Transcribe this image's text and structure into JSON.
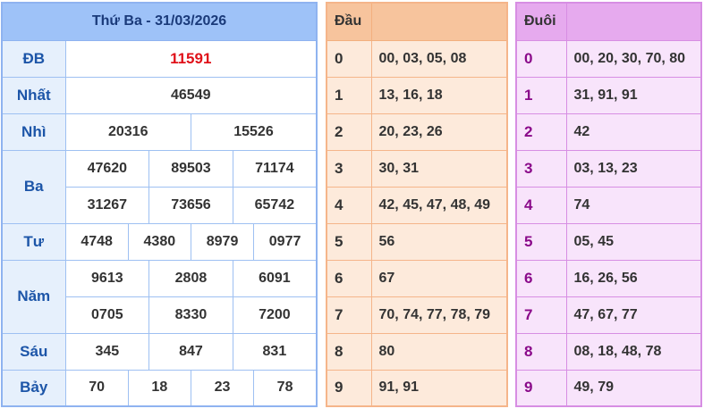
{
  "results": {
    "header": "Thứ Ba - 31/03/2026",
    "labels": {
      "db": "ĐB",
      "nhat": "Nhất",
      "nhi": "Nhì",
      "ba": "Ba",
      "tu": "Tư",
      "nam": "Năm",
      "sau": "Sáu",
      "bay": "Bảy"
    },
    "db": "11591",
    "nhat": "46549",
    "nhi": [
      "20316",
      "15526"
    ],
    "ba": [
      "47620",
      "89503",
      "71174",
      "31267",
      "73656",
      "65742"
    ],
    "tu": [
      "4748",
      "4380",
      "8979",
      "0977"
    ],
    "nam": [
      "9613",
      "2808",
      "6091",
      "0705",
      "8330",
      "7200"
    ],
    "sau": [
      "345",
      "847",
      "831"
    ],
    "bay": [
      "70",
      "18",
      "23",
      "78"
    ]
  },
  "dau": {
    "header": "Đầu",
    "rows": [
      {
        "idx": "0",
        "vals": "00, 03, 05, 08"
      },
      {
        "idx": "1",
        "vals": "13, 16, 18"
      },
      {
        "idx": "2",
        "vals": "20, 23, 26"
      },
      {
        "idx": "3",
        "vals": "30, 31"
      },
      {
        "idx": "4",
        "vals": "42, 45, 47, 48, 49"
      },
      {
        "idx": "5",
        "vals": "56"
      },
      {
        "idx": "6",
        "vals": "67"
      },
      {
        "idx": "7",
        "vals": "70, 74, 77, 78, 79"
      },
      {
        "idx": "8",
        "vals": "80"
      },
      {
        "idx": "9",
        "vals": "91, 91"
      }
    ]
  },
  "duoi": {
    "header": "Đuôi",
    "rows": [
      {
        "idx": "0",
        "vals": "00, 20, 30, 70, 80"
      },
      {
        "idx": "1",
        "vals": "31, 91, 91"
      },
      {
        "idx": "2",
        "vals": "42"
      },
      {
        "idx": "3",
        "vals": "03, 13, 23"
      },
      {
        "idx": "4",
        "vals": "74"
      },
      {
        "idx": "5",
        "vals": "05, 45"
      },
      {
        "idx": "6",
        "vals": "16, 26, 56"
      },
      {
        "idx": "7",
        "vals": "47, 67, 77"
      },
      {
        "idx": "8",
        "vals": "08, 18, 48, 78"
      },
      {
        "idx": "9",
        "vals": "49, 79"
      }
    ]
  },
  "colors": {
    "results_header_bg": "#9ec2f8",
    "results_label_bg": "#e6f0fc",
    "special_prize": "#e0121a",
    "dau_header_bg": "#f7c49d",
    "dau_cell_bg": "#fdeadb",
    "duoi_header_bg": "#e6aaee",
    "duoi_cell_bg": "#f8e4fb"
  }
}
